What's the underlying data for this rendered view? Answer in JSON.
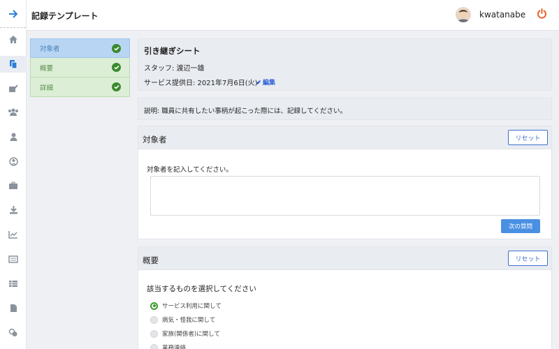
{
  "app": {
    "title": "記録テンプレート"
  },
  "user": {
    "name": "kwatanabe"
  },
  "steps": [
    {
      "label": "対象者",
      "state": "active"
    },
    {
      "label": "概要",
      "state": "done"
    },
    {
      "label": "詳細",
      "state": "done"
    }
  ],
  "info": {
    "heading": "引き継ぎシート",
    "staff": "スタッフ: 渡辺一雄",
    "date": "サービス提供日: 2021年7月6日(火)",
    "edit_label": "編集"
  },
  "description": "説明: 職員に共有したい事柄が起こった際には、記録してください。",
  "section_target": {
    "title": "対象者",
    "reset_label": "リセット",
    "prompt": "対象者を記入してください。",
    "input_value": "",
    "next_label": "次の質問"
  },
  "section_summary": {
    "title": "概要",
    "reset_label": "リセット",
    "question": "該当するものを選択してください",
    "options": [
      {
        "label": "サービス利用に関して",
        "selected": true
      },
      {
        "label": "病気・怪我に関して",
        "selected": false
      },
      {
        "label": "家族(関係者)に関して",
        "selected": false
      },
      {
        "label": "業務連絡",
        "selected": false
      }
    ]
  },
  "icons": {
    "rail": [
      "arrow-right-icon",
      "home-icon",
      "documents-icon",
      "edit-chart-icon",
      "group-icon",
      "person-icon",
      "user-circle-icon",
      "briefcase-icon",
      "download-icon",
      "line-chart-icon",
      "list-icon",
      "table-icon",
      "file-icon",
      "coins-icon"
    ]
  },
  "colors": {
    "accent": "#3d6fd1",
    "success": "#3a8a2f",
    "power": "#e8622a",
    "active_step": "#b8d6f3",
    "done_step": "#dcefd6"
  }
}
